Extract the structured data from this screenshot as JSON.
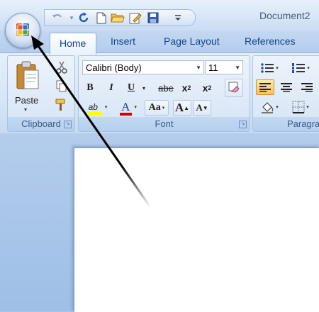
{
  "window": {
    "title": "Document2"
  },
  "tabs": [
    "Home",
    "Insert",
    "Page Layout",
    "References"
  ],
  "clipboard": {
    "paste_label": "Paste",
    "group_label": "Clipboard"
  },
  "font": {
    "font_name": "Calibri (Body)",
    "font_size": "11",
    "bold": "B",
    "italic": "I",
    "underline": "U",
    "strike": "abe",
    "subscript": "x",
    "subscript_mark": "2",
    "superscript": "x",
    "superscript_mark": "2",
    "change_case": "Aa",
    "grow": "A",
    "shrink": "A",
    "highlight": "ab",
    "font_color": "A",
    "group_label": "Font"
  },
  "paragraph": {
    "group_label": "Paragra"
  },
  "colors": {
    "accent": "#15428b",
    "font_color_bar": "#d40000",
    "highlight_bar": "#ffff00",
    "arrow": "#000000"
  },
  "icons": [
    "office-button-icon",
    "undo-icon",
    "redo-icon",
    "new-icon",
    "open-icon",
    "edit-icon",
    "save-icon",
    "customize-icon",
    "paste-icon",
    "cut-icon",
    "copy-icon",
    "format-painter-icon",
    "clear-format-icon",
    "bullets-icon",
    "numbering-icon",
    "align-left-icon",
    "align-center-icon",
    "align-right-icon",
    "shading-icon",
    "borders-icon"
  ]
}
